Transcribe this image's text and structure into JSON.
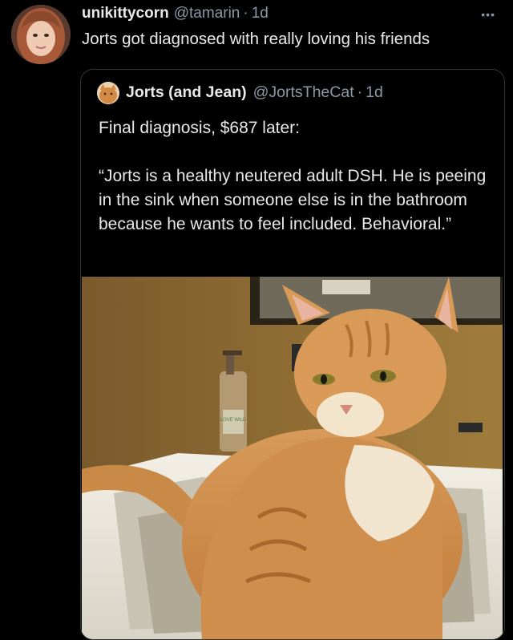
{
  "tweet": {
    "display_name": "unikittycorn",
    "handle": "@tamarin",
    "separator": "·",
    "time": "1d",
    "more_icon": "•••",
    "text": "Jorts got diagnosed with really loving his friends"
  },
  "quoted_tweet": {
    "display_name": "Jorts (and Jean)",
    "handle": "@JortsTheCat",
    "separator": "·",
    "time": "1d",
    "line1": "Final diagnosis, $687 later:",
    "line2": "“Jorts is a healthy neutered adult DSH. He is peeing in the sink when someone else is in the bathroom because he wants to feel included. Behavioral.”",
    "photo_label": "LOVE WILD"
  },
  "colors": {
    "background": "#000000",
    "text": "#e7e9ea",
    "secondary": "#8b98a5",
    "border": "#2f3336"
  },
  "icons": {
    "more": "more-horizontal-icon"
  }
}
